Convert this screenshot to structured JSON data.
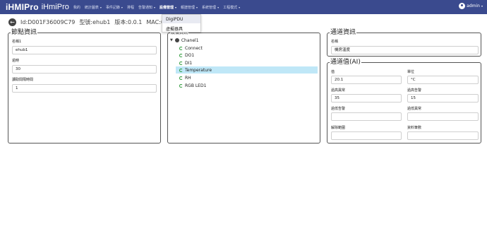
{
  "brand": {
    "name": "iHMIPro",
    "subtitle": "iHmiPro"
  },
  "nav": {
    "items": [
      {
        "label": "我的",
        "caret": ""
      },
      {
        "label": "統計圖表",
        "caret": "▾"
      },
      {
        "label": "事件記錄",
        "caret": "▾"
      },
      {
        "label": "排程",
        "caret": ""
      },
      {
        "label": "告警通知",
        "caret": "▾"
      },
      {
        "label": "設備管理",
        "caret": "▾",
        "active": true
      },
      {
        "label": "報譜管理",
        "caret": "▾"
      },
      {
        "label": "系統管理",
        "caret": "▾"
      },
      {
        "label": "工程模式",
        "caret": "▾"
      }
    ],
    "user": "admin",
    "user_caret": "▾"
  },
  "dropdown": {
    "items": [
      "DigiPDU",
      "虛擬器具"
    ]
  },
  "infobar": {
    "back_glyph": "←",
    "id": "Id:D001F36009C79",
    "model": "型號:ehub1",
    "version": "版本:0.0.1",
    "mac": "MAC:00:1F:"
  },
  "node_panel": {
    "legend": "節點資訊",
    "name_label": "名稱1",
    "name_value": "ehub1",
    "timeout_label": "逾時",
    "timeout_value": "30",
    "interval_label": "讀取間隔時間",
    "interval_value": "1"
  },
  "tree_panel": {
    "legend": "設備資訊",
    "root": "Chanel1",
    "root_toggle": "▼",
    "children": [
      "Connect",
      "DO1",
      "DI1",
      "Temperature",
      "RH",
      "RGB LED1"
    ],
    "selected": "Temperature"
  },
  "channel_panel": {
    "legend": "通道資訊",
    "name_label": "名稱",
    "name_value": "機房溫度"
  },
  "ai_panel": {
    "legend": "通道值(AI)",
    "value_label": "值",
    "value": "20.1",
    "unit_label": "單位",
    "unit": "°C",
    "high_alarm_label": "過高異常",
    "high_alarm": "35",
    "high_warn_label": "過高告警",
    "high_warn": "15",
    "low_warn_label": "過低告警",
    "low_warn": "",
    "low_alarm_label": "過低異常",
    "low_alarm": "",
    "deadband_label": "解除範圍",
    "deadband": "",
    "decimals_label": "資料筆數",
    "decimals": ""
  },
  "colors": {
    "navbar": "#3a4a8e",
    "selected_row": "#bfe7f7",
    "tree_icon": "#2e9a3a"
  }
}
